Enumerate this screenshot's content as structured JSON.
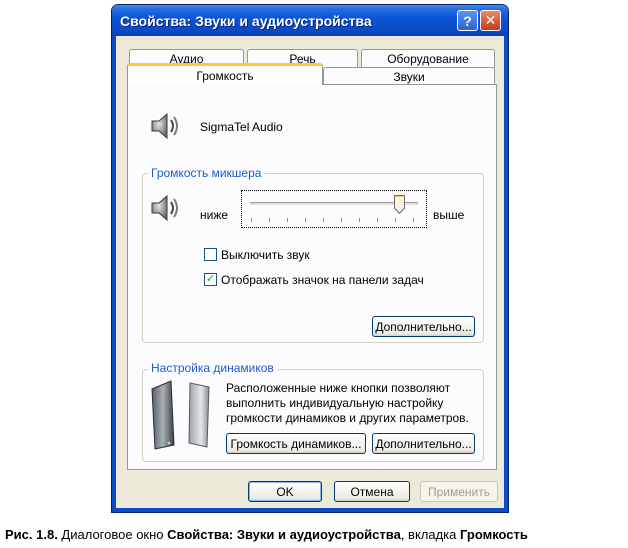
{
  "window": {
    "title": "Свойства: Звуки и аудиоустройства",
    "help_glyph": "?",
    "close_glyph": "✕"
  },
  "tabs": [
    {
      "label": "Аудио",
      "active": false
    },
    {
      "label": "Речь",
      "active": false
    },
    {
      "label": "Оборудование",
      "active": false
    },
    {
      "label": "Громкость",
      "active": true
    },
    {
      "label": "Звуки",
      "active": false
    }
  ],
  "device": {
    "name": "SigmaTel Audio",
    "icon": "speaker-icon"
  },
  "mixer": {
    "group_label": "Громкость микшера",
    "low_label": "ниже",
    "high_label": "выше",
    "level_fraction": 0.92,
    "mute_label": "Выключить звук",
    "mute_checked": false,
    "taskbar_icon_label": "Отображать значок на панели задач",
    "taskbar_icon_checked": true,
    "advanced_button": "Дополнительно..."
  },
  "speakers": {
    "group_label": "Настройка динамиков",
    "description_lines": [
      "Расположенные ниже кнопки позволяют",
      "выполнить индивидуальную настройку",
      "громкости динамиков и других параметров."
    ],
    "volume_button": "Громкость динамиков...",
    "advanced_button": "Дополнительно..."
  },
  "footer": {
    "ok": "OK",
    "cancel": "Отмена",
    "apply": "Применить"
  },
  "caption": {
    "prefix": "Рис. 1.8.",
    "text1": " Диалоговое окно ",
    "bold1": "Свойства: Звуки и аудиоустройства",
    "text2": ", вкладка ",
    "bold2": "Громкость"
  },
  "colors": {
    "titlebar": "#0a4bc6",
    "group_label": "#1d5ad0",
    "tab_highlight": "#ffc73c",
    "dialog_bg": "#ece9d8"
  }
}
